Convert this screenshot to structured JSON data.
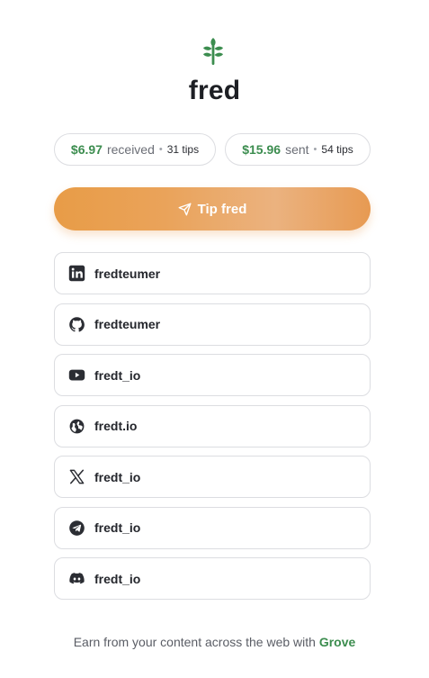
{
  "profile": {
    "username": "fred"
  },
  "stats": {
    "received": {
      "amount": "$6.97",
      "word": "received",
      "separator": "•",
      "tips": "31 tips"
    },
    "sent": {
      "amount": "$15.96",
      "word": "sent",
      "separator": "•",
      "tips": "54 tips"
    }
  },
  "tip_button": {
    "label": "Tip fred",
    "icon": "send-icon"
  },
  "links": [
    {
      "icon": "linkedin-icon",
      "label": "fredteumer"
    },
    {
      "icon": "github-icon",
      "label": "fredteumer"
    },
    {
      "icon": "youtube-icon",
      "label": "fredt_io"
    },
    {
      "icon": "globe-icon",
      "label": "fredt.io"
    },
    {
      "icon": "x-icon",
      "label": "fredt_io"
    },
    {
      "icon": "telegram-icon",
      "label": "fredt_io"
    },
    {
      "icon": "discord-icon",
      "label": "fredt_io"
    }
  ],
  "footer": {
    "text": "Earn from your content across the web with",
    "brand": "Grove"
  },
  "colors": {
    "accent_green": "#3c8d4f",
    "tip_button_orange": "#e89c47",
    "border": "#dcdde1"
  }
}
